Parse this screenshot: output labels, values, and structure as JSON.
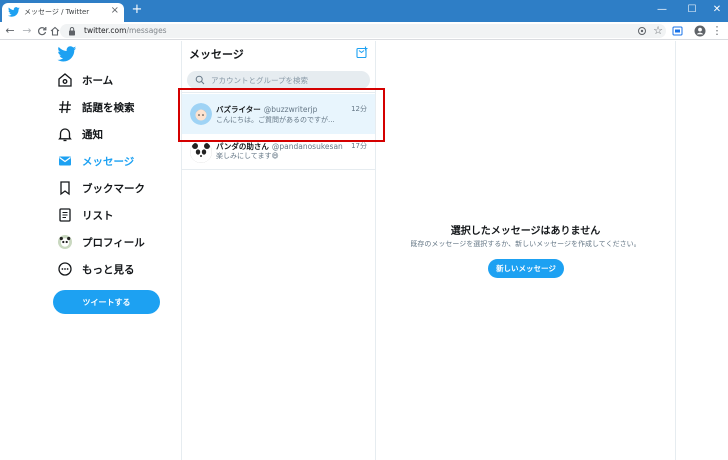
{
  "browser": {
    "tab_title": "メッセージ / Twitter",
    "tab_close": "×",
    "new_tab": "+",
    "url_host": "twitter.com",
    "url_path": "/messages",
    "window_controls": {
      "minimize": "—",
      "maximize": "☐",
      "close": "✕"
    },
    "nav": {
      "back": "←",
      "forward": "→",
      "reload": "C",
      "home": "⌂"
    }
  },
  "nav": {
    "items": [
      {
        "label": "ホーム",
        "icon": "home-icon"
      },
      {
        "label": "話題を検索",
        "icon": "hashtag-icon"
      },
      {
        "label": "通知",
        "icon": "bell-icon"
      },
      {
        "label": "メッセージ",
        "icon": "envelope-icon",
        "active": true
      },
      {
        "label": "ブックマーク",
        "icon": "bookmark-icon"
      },
      {
        "label": "リスト",
        "icon": "list-icon"
      },
      {
        "label": "プロフィール",
        "icon": "avatar-icon"
      },
      {
        "label": "もっと見る",
        "icon": "more-icon"
      }
    ],
    "tweet_button": "ツイートする"
  },
  "messages": {
    "title": "メッセージ",
    "search_placeholder": "アカウントとグループを検索",
    "conversations": [
      {
        "name": "バズライター",
        "handle": "@buzzwriterjp",
        "time": "12分",
        "preview": "こんにちは。ご質問があるのですが..."
      },
      {
        "name": "パンダの助さん",
        "handle": "@pandanosukesan",
        "time": "17分",
        "preview": "楽しみにしてます😄"
      }
    ]
  },
  "empty_state": {
    "title": "選択したメッセージはありません",
    "description": "既存のメッセージを選択するか、新しいメッセージを作成してください。",
    "button": "新しいメッセージ"
  },
  "colors": {
    "accent": "#1da1f2",
    "browser_bar": "#2e7ec6",
    "highlight": "#d40000",
    "selected_row": "#e8f5fd"
  }
}
